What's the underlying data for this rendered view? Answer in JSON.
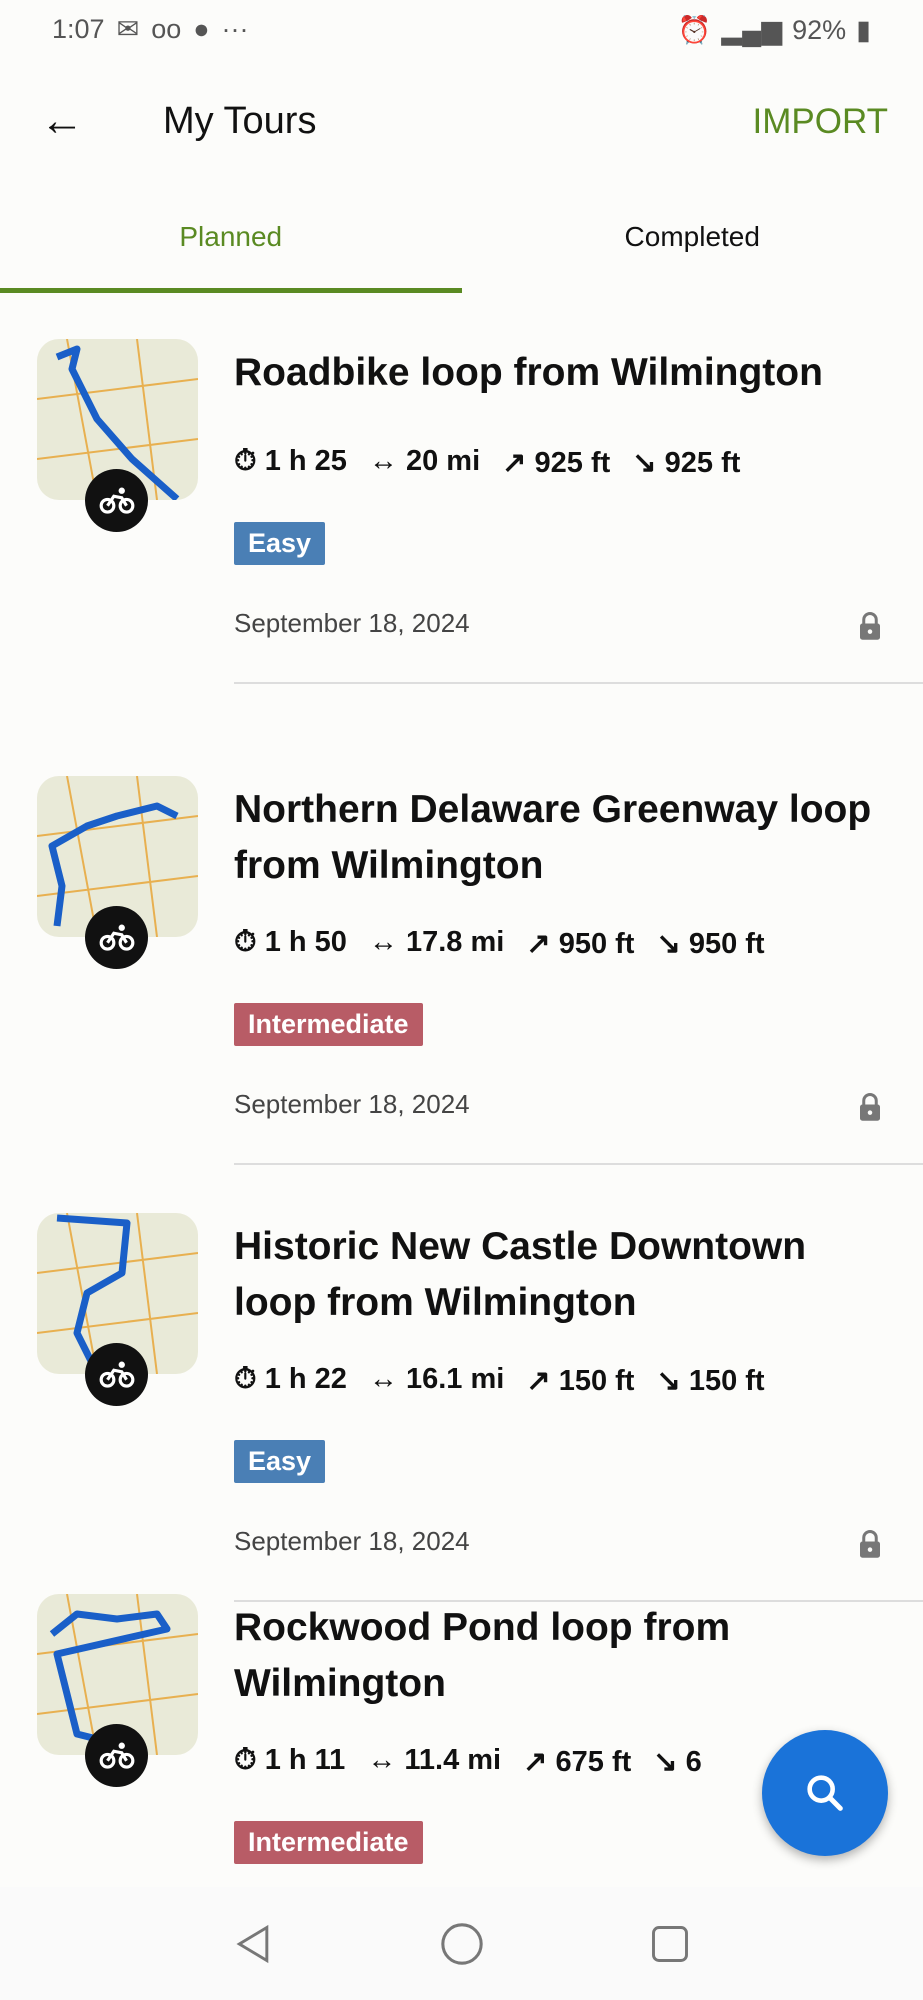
{
  "status_bar": {
    "time": "1:07",
    "battery": "92%"
  },
  "header": {
    "title": "My Tours",
    "import_label": "IMPORT"
  },
  "tabs": [
    {
      "label": "Planned",
      "active": true
    },
    {
      "label": "Completed",
      "active": false
    }
  ],
  "colors": {
    "accent": "#5a8a22",
    "easy": "#4a7fb5",
    "intermediate": "#b85c66",
    "fab": "#1a73d9"
  },
  "tours": [
    {
      "title": "Roadbike loop from Wilmington",
      "duration": "1 h 25",
      "distance": "20 mi",
      "ascent": "925 ft",
      "descent": "925 ft",
      "difficulty": "Easy",
      "date": "September 18, 2024",
      "sport_icon": "bike-icon"
    },
    {
      "title": "Northern Delaware Greenway loop from Wilmington",
      "duration": "1 h 50",
      "distance": "17.8 mi",
      "ascent": "950 ft",
      "descent": "950 ft",
      "difficulty": "Intermediate",
      "date": "September 18, 2024",
      "sport_icon": "bike-icon"
    },
    {
      "title": "Historic New Castle Downtown loop from Wilmington",
      "duration": "1 h 22",
      "distance": "16.1 mi",
      "ascent": "150 ft",
      "descent": "150 ft",
      "difficulty": "Easy",
      "date": "September 18, 2024",
      "sport_icon": "bike-icon"
    },
    {
      "title": "Rockwood Pond loop from Wilmington",
      "duration": "1 h 11",
      "distance": "11.4 mi",
      "ascent": "675 ft",
      "descent": "6",
      "difficulty": "Intermediate",
      "sport_icon": "bike-icon"
    }
  ]
}
